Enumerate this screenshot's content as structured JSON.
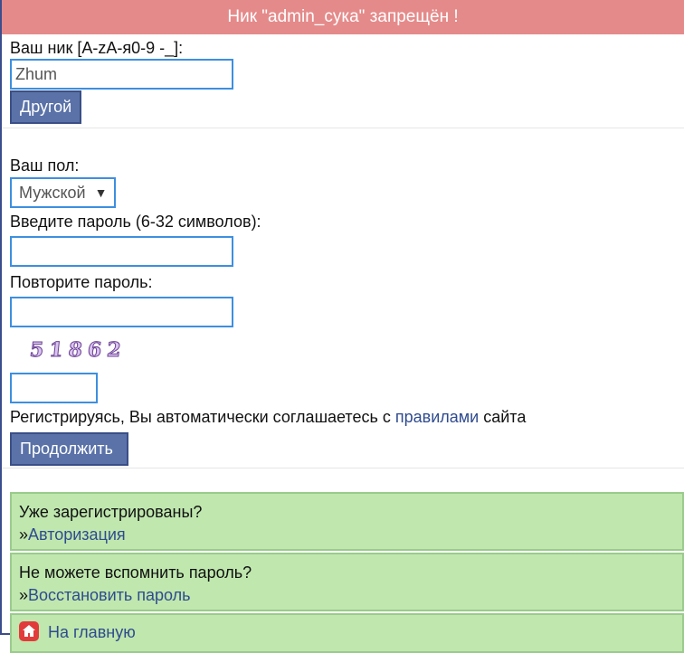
{
  "error_message": "Ник \"admin_сука\" запрещён !",
  "nick": {
    "label": "Ваш ник [A-zA-я0-9 -_]:",
    "value": "Zhum",
    "other_button": "Другой"
  },
  "gender": {
    "label": "Ваш пол:",
    "selected": "Мужской"
  },
  "password": {
    "label": "Введите пароль (6-32 символов):",
    "value": ""
  },
  "repeat_password": {
    "label": "Повторите пароль:",
    "value": ""
  },
  "captcha": {
    "code": "51862",
    "value": ""
  },
  "terms": {
    "prefix": "Регистрируясь, Вы автоматически соглашаетесь с ",
    "link": "правилами",
    "suffix": " сайта"
  },
  "continue_button": "Продолжить",
  "login_box": {
    "question": "Уже зарегистрированы?",
    "arrow": "»",
    "link": "Авторизация"
  },
  "recover_box": {
    "question": "Не можете вспомнить пароль?",
    "arrow": "»",
    "link": "Восстановить пароль"
  },
  "home_box": {
    "icon": "home-icon",
    "link": "На главную"
  },
  "colors": {
    "error_bar": "#e58a8a",
    "button": "#5a72a8",
    "input_border": "#3d8fe0",
    "green_box": "#bfe7ae",
    "link": "#2f4b8f"
  }
}
